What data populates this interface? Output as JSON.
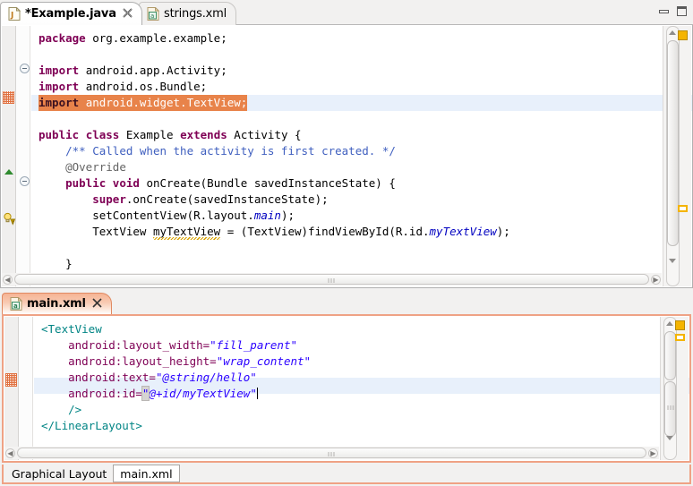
{
  "window": {
    "minimize_label": "Minimize",
    "maximize_label": "Maximize"
  },
  "java_editor": {
    "tabs": [
      {
        "label": "*Example.java",
        "icon": "java-file-icon",
        "active": true,
        "close": "✖"
      },
      {
        "label": "strings.xml",
        "icon": "xml-file-icon",
        "active": false
      }
    ],
    "close_glyph": "✖",
    "code_lines": [
      "package org.example.example;",
      "",
      "import android.app.Activity;",
      "import android.os.Bundle;",
      "import android.widget.TextView;",
      "",
      "public class Example extends Activity {",
      "    /** Called when the activity is first created. */",
      "    @Override",
      "    public void onCreate(Bundle savedInstanceState) {",
      "        super.onCreate(savedInstanceState);",
      "        setContentView(R.layout.main);",
      "        TextView myTextView = (TextView)findViewById(R.id.myTextView);",
      "",
      "    }",
      "}"
    ],
    "tokens": {
      "package": "package",
      "import": "import",
      "public": "public",
      "class": "class",
      "extends": "extends",
      "void": "void",
      "super": "super",
      "override": "@Override",
      "javadoc": "/** Called when the activity is first created. */",
      "pkg_name": "org.example.example;",
      "imp_activity": "android.app.Activity;",
      "imp_bundle": "android.os.Bundle;",
      "imp_textview": "android.widget.TextView;",
      "class_name": "Example",
      "superclass": "Activity {",
      "method_sig": "onCreate(Bundle savedInstanceState) {",
      "super_call": ".onCreate(savedInstanceState);",
      "setcontent_pre": "setContentView(R.layout.",
      "setcontent_field": "main",
      "setcontent_post": ");",
      "tv_decl_a": "TextView ",
      "tv_decl_var": "myTextView",
      "tv_decl_b": " = (TextView)findViewById(R.id.",
      "tv_decl_field": "myTextView",
      "tv_decl_c": ");",
      "close_method": "}",
      "close_class": "}"
    },
    "markers": {
      "highlighted_import_line": "import android.widget.TextView;",
      "warning_icon": "quickfix-warning-bulb-icon",
      "green_triangle": "override-indicator-icon",
      "fold_collapse": "folding-collapse-icon"
    }
  },
  "xml_editor": {
    "tab": {
      "label": "main.xml",
      "icon": "xml-file-icon",
      "close": "✖"
    },
    "code_lines": [
      "<TextView",
      "    android:layout_width=\"fill_parent\"",
      "    android:layout_height=\"wrap_content\"",
      "    android:text=\"@string/hello\"",
      "    android:id=\"@+id/myTextView\"",
      "    />",
      "</LinearLayout>"
    ],
    "tokens": {
      "open_tag": "<TextView",
      "attr_width": "android:layout_width=",
      "val_width": "\"fill_parent\"",
      "attr_height": "android:layout_height=",
      "val_height": "\"wrap_content\"",
      "attr_text": "android:text=",
      "val_text": "\"@string/hello\"",
      "attr_id": "android:id=",
      "val_id_q1": "\"",
      "val_id": "@+id/myTextView",
      "val_id_q2": "\"",
      "self_close": "/>",
      "close_tag": "</LinearLayout>"
    },
    "highlighted_line": "    android:id=\"@+id/myTextView\"",
    "page_tabs": [
      {
        "label": "Graphical Layout",
        "selected": false
      },
      {
        "label": "main.xml",
        "selected": true
      }
    ]
  },
  "colors": {
    "keyword": "#7f0055",
    "javadoc": "#3f5fbf",
    "field": "#0000c0",
    "xml_tag": "#008484",
    "xml_attr": "#7f0055",
    "xml_value": "#2a00ff",
    "highlight_orange": "#e8834a",
    "line_highlight": "#e8f0fb",
    "tab_accent": "#efa285",
    "marker_yellow": "#f4b400"
  }
}
